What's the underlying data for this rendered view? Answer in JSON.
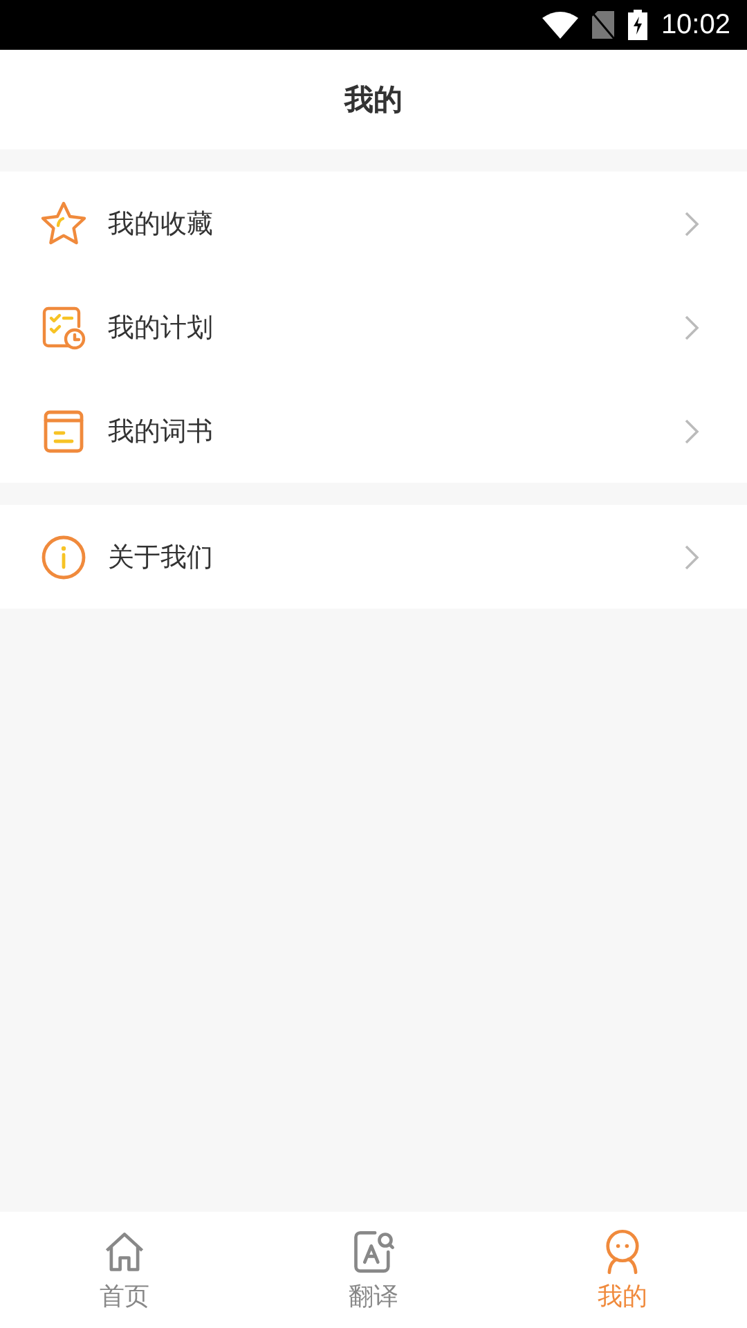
{
  "status_bar": {
    "time": "10:02"
  },
  "header": {
    "title": "我的"
  },
  "groups": [
    {
      "items": [
        {
          "kind": "star",
          "label": "我的收藏"
        },
        {
          "kind": "plan",
          "label": "我的计划"
        },
        {
          "kind": "book",
          "label": "我的词书"
        }
      ]
    },
    {
      "items": [
        {
          "kind": "info",
          "label": "关于我们"
        }
      ]
    }
  ],
  "tabs": [
    {
      "kind": "home",
      "label": "首页",
      "selected": false
    },
    {
      "kind": "translate",
      "label": "翻译",
      "selected": false
    },
    {
      "kind": "me",
      "label": "我的",
      "selected": true
    }
  ]
}
